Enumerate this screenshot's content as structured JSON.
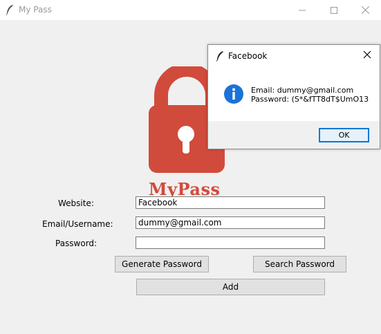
{
  "window": {
    "title": "My Pass",
    "title_icon": "feather-icon"
  },
  "logo": {
    "text": "MyPass",
    "icon": "padlock-icon",
    "color": "#d14b3c"
  },
  "form": {
    "website_label": "Website:",
    "website_value": "Facebook",
    "email_label": "Email/Username:",
    "email_value": "dummy@gmail.com",
    "password_label": "Password:",
    "password_value": "",
    "generate_label": "Generate Password",
    "search_label": "Search Password",
    "add_label": "Add"
  },
  "dialog": {
    "title": "Facebook",
    "icon": "info-icon",
    "email_line": "Email: dummy@gmail.com",
    "password_line": "Password: (S*&fTT8dT$UmO13",
    "ok_label": "OK",
    "accent": "#0078d7"
  }
}
